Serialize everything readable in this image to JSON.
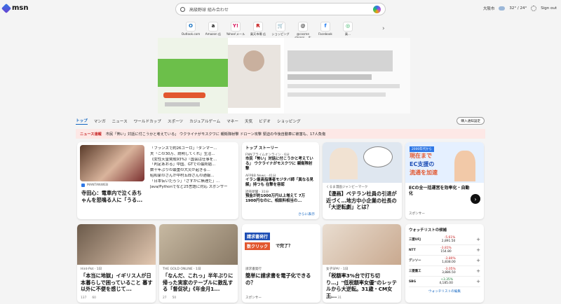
{
  "header": {
    "logo_text": "msn",
    "search_query": "高級野球 組み合わせ",
    "location": "大阪市",
    "temperature": "32° / 24°",
    "signin": "Sign out"
  },
  "quick_links": [
    {
      "label": "Outlook.com",
      "icon": "outlook-icon",
      "color": "#0f6cbd",
      "glyph": "O"
    },
    {
      "label": "Amazon 広",
      "icon": "amazon-icon",
      "color": "#111111",
      "glyph": "a"
    },
    {
      "label": "Yahoo!メール",
      "icon": "yahoo-icon",
      "color": "#d81b60",
      "glyph": "Y!"
    },
    {
      "label": "楽天市場 広",
      "icon": "rakuten-icon",
      "color": "#bf0000",
      "glyph": "R"
    },
    {
      "label": "ショッピング",
      "icon": "shopping-icon",
      "color": "#2f78e6",
      "glyph": "🛒"
    },
    {
      "label": "@cosme shoppi... 広",
      "icon": "cosme-icon",
      "color": "#444444",
      "glyph": "@"
    },
    {
      "label": "Facebook",
      "icon": "facebook-icon",
      "color": "#1877f2",
      "glyph": "f"
    },
    {
      "label": "楽...",
      "icon": "more-icon",
      "color": "#22aa55",
      "glyph": "◎"
    }
  ],
  "nav": {
    "tabs": [
      "トップ",
      "マンガ",
      "ニュース",
      "ワールドカップ",
      "スポーツ",
      "カジュアルゲーム",
      "マネー",
      "天気",
      "ビデオ",
      "ショッピング"
    ],
    "follow": "購入通知設定"
  },
  "alert": {
    "label": "ニュース速報",
    "text": "市民「怖い」対話に付こうかと考えている」 ウクライナがモスクワに 親衛隊射撃 ドローン攻撃 緊迫の今後自動車に被害も、17人負傷"
  },
  "news_card": {
    "source": "MANTANWEB",
    "title": "寺田心：電車内で泣く赤ちゃんを怒鳴る人に「うる...",
    "lines": [
      "「フランスで約26ユーロ」「ダンマー...",
      "夫「この30万、説明してくれ」生活...",
      "《女性天皇賛成93%》『国会は仕事を...",
      "「判定あおる」中国、GTでの最終結...",
      "数十年ぶりの最重の大災が起きる...",
      "昭和家のさんが中村五郎さんの通報...",
      "「日本伝いだろう」「さすがに無理だ」...",
      "Java/Pythonでなど25言語に対応 スポンサー"
    ]
  },
  "top_stories": {
    "header": "トップ ストーリー",
    "items": [
      {
        "source": "FNNプライムオンライン · 6分",
        "title": "市民「怖い」対話に付こうかと考えている」 ウクライナがモスクワに 親衛隊射撃"
      },
      {
        "source": "AFPBB News · 41分",
        "title": "イラン最高指導者モジタバ師「異なる見解」持つも 在撃を容認"
      },
      {
        "source": "読売新聞 · 31分",
        "title": "預金が約1000万円以上増えて 7万1900円なのに、相談料相当の..."
      }
    ],
    "more": "さらに表示"
  },
  "manga_card": {
    "source": "くるま漫画ジャンビーマーク",
    "title": "【漫画】ベテラン社員の引退が近づく…地方中小企業の社長の「大逆転劇」とは？"
  },
  "ad_card": {
    "banner1": "2000年代から",
    "banner2": "現在まで",
    "banner3": "EC支援の",
    "banner4": "流通を加速",
    "title": "ECの全一括運営を効率化・自動化",
    "sponsor": "スポンサー"
  },
  "row2": [
    {
      "source": "Hint-Pot · 1日",
      "title": "「本当に地獄」イギリス人が日本暮らしで困っていること 暮す以外に不便を感じて...",
      "likes": "137",
      "comments": "60"
    },
    {
      "source": "THE GOLD ONLINE · 1日",
      "title": "「なんだ、これっ」半年ぶりに帰った実家のテーブルに散乱する「督促状」《年金月1...",
      "likes": "27",
      "comments": "50"
    },
    {
      "source": "請求書発行",
      "title": "簡単に請求書を電子化できるの？",
      "ad1": "請求書発行",
      "ad2": "数クリック",
      "ad3": "で完了？",
      "sponsor": "スポンサー"
    },
    {
      "source": "女子SPA! · 1日",
      "title": "「税額率3%台で打ち切り…」\"低税額率女優\"のレッテルから大逆転。31歳・CM女王...",
      "likes": "140",
      "comments": "31"
    }
  ],
  "watchlist": {
    "title": "ウォッチリストの候補",
    "rows": [
      {
        "name": "三菱UFJ",
        "change": "-5.61%",
        "price": "2,891.50"
      },
      {
        "name": "NTT",
        "change": "-3.81%",
        "price": "154.80"
      },
      {
        "name": "デンソー",
        "change": "-3.80%",
        "price": "1,838.00"
      },
      {
        "name": "三菱重工",
        "change": "-3.05%",
        "price": "3,886.50"
      },
      {
        "name": "SBG",
        "change": "+3.35%",
        "price": "4,185.00"
      }
    ],
    "more": "ウォッチリストの編集"
  },
  "colors": {
    "accent": "#1366c1",
    "alert_bg": "#fde8e6",
    "alert_text": "#c51d1d"
  }
}
